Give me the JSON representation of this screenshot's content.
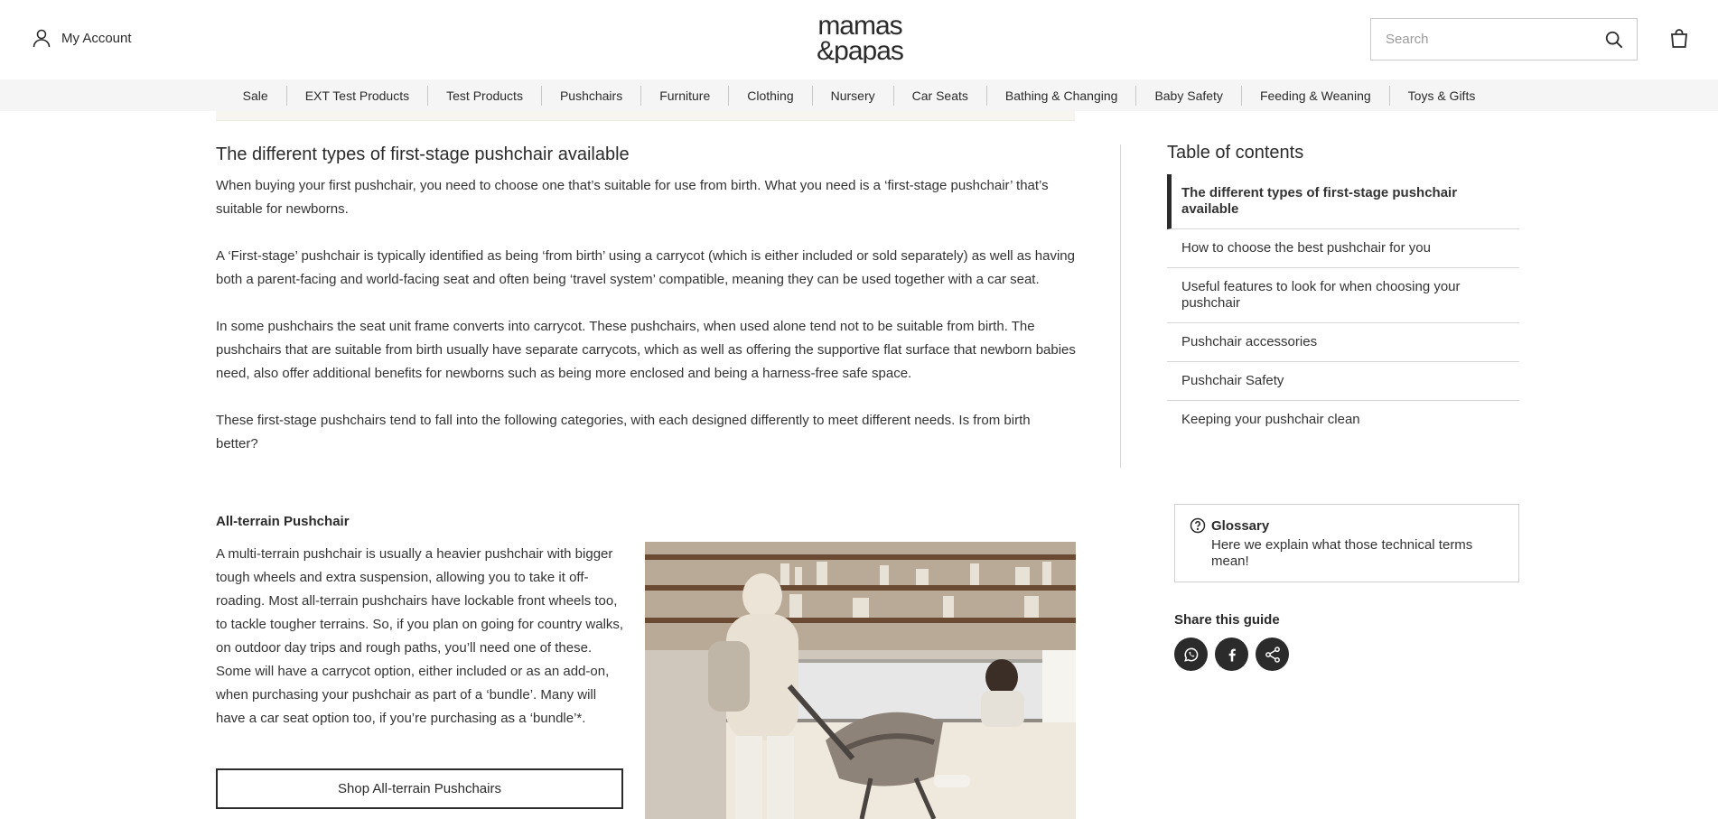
{
  "header": {
    "account_label": "My Account",
    "search_placeholder": "Search",
    "logo_line1": "mamas",
    "logo_line2": "&papas"
  },
  "nav": {
    "items": [
      "Sale",
      "EXT Test Products",
      "Test Products",
      "Pushchairs",
      "Furniture",
      "Clothing",
      "Nursery",
      "Car Seats",
      "Bathing & Changing",
      "Baby Safety",
      "Feeding & Weaning",
      "Toys & Gifts"
    ]
  },
  "article": {
    "heading": "The different types of first-stage pushchair available",
    "paragraphs": [
      "When buying your first pushchair, you need to choose one that’s suitable for use from birth. What you need is a ‘first-stage pushchair’ that’s suitable for newborns.",
      "A ‘First-stage’ pushchair is typically identified as being ‘from birth’ using a carrycot (which is either included or sold separately) as well as having both a parent-facing and world-facing seat and often being ‘travel system’ compatible, meaning they can be used together with a car seat.",
      "In some pushchairs the seat unit frame converts into carrycot. These pushchairs, when used alone tend not to be suitable from birth. The pushchairs that are suitable from birth usually have separate carrycots, which as well as offering the supportive flat surface that newborn babies need, also offer additional benefits for newborns such as being more enclosed and being a harness-free safe space.",
      "These first-stage pushchairs tend to fall into the following categories, with each designed differently to meet different needs. Is from birth better?"
    ],
    "subheading": "All-terrain Pushchair",
    "subtext": "A multi-terrain pushchair is usually a heavier pushchair with bigger tough wheels and extra suspension, allowing you to take it off-roading. Most all-terrain pushchairs have lockable front wheels too, to tackle tougher terrains. So, if you plan on going for country walks, on outdoor day trips and rough paths, you’ll need one of these.  Some will have a carrycot option, either included or as an add-on, when purchasing your pushchair as part of a ‘bundle’. Many will have a car seat option too, if you’re purchasing as a ‘bundle’*.",
    "shop_button": "Shop All-terrain Pushchairs"
  },
  "sidebar": {
    "toc_title": "Table of contents",
    "toc_items": [
      "The different types of first-stage pushchair available",
      "How to choose the best pushchair for you",
      "Useful features to look for when choosing your pushchair",
      "Pushchair accessories",
      "Pushchair Safety",
      "Keeping your pushchair clean"
    ],
    "glossary_title": "Glossary",
    "glossary_text": "Here we explain what those technical terms mean!",
    "share_title": "Share this guide"
  },
  "icons": {
    "account": "user-icon",
    "search": "search-icon",
    "bag": "shopping-bag-icon",
    "glossary": "question-circle-icon",
    "share": [
      "whatsapp-icon",
      "facebook-icon",
      "share-icon"
    ]
  },
  "colors": {
    "text": "#2b2b2b",
    "nav_bg": "#f5f5f5",
    "share_bg": "#2b2b2b"
  }
}
